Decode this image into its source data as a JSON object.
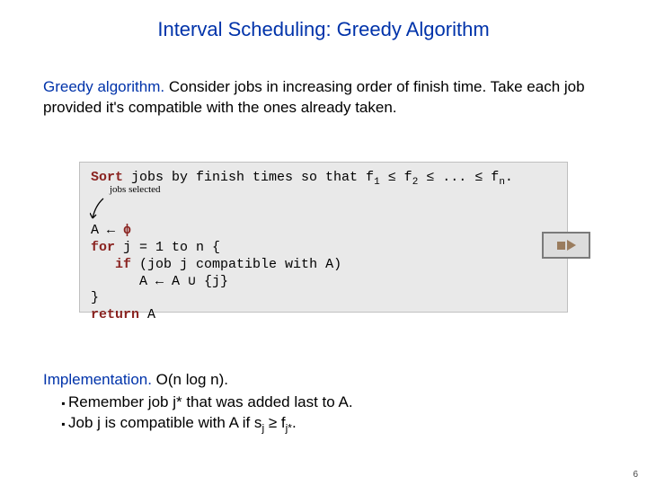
{
  "title": "Interval Scheduling: Greedy Algorithm",
  "para1": {
    "lead": "Greedy algorithm.",
    "rest": " Consider jobs in increasing order of finish time. Take each job provided it's compatible with the ones already taken."
  },
  "code": {
    "sort_kw": "Sort",
    "sort_rest": " jobs by finish times so that f",
    "sort_mid1": " ≤ f",
    "sort_mid2": " ≤ ... ≤ f",
    "sort_end": ".",
    "line_assign_pre": "A ← ",
    "phi": "ϕ",
    "for_kw": "for",
    "for_rest": " j = 1 to n {",
    "if_kw": "if",
    "if_rest": " (job j compatible with A)",
    "union_line": "      A ← A ∪ {j}",
    "close": "}",
    "return_kw": "return",
    "return_rest": " A",
    "sub1": "1",
    "sub2": "2",
    "subn": "n"
  },
  "annotation": "jobs selected",
  "impl": {
    "lead": "Implementation.",
    "rest": " O(n log n).",
    "bullet1": "Remember job j* that was added last to A.",
    "bullet2_pre": "Job j is compatible with A if s",
    "bullet2_sub1": "j",
    "bullet2_mid": " ≥ f",
    "bullet2_sub2": "j*",
    "bullet2_end": "."
  },
  "page_number": "6"
}
